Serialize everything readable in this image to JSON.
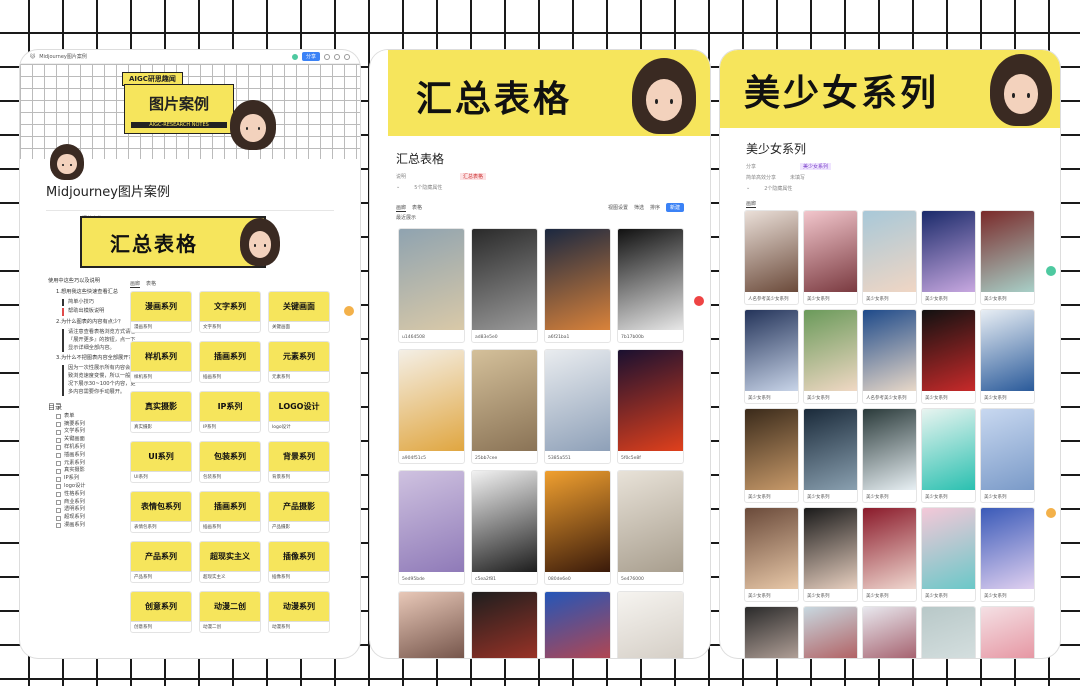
{
  "panel1": {
    "tab_title": "Midjourney图片案例",
    "share": "分享",
    "cover_badge": "AIGC研思趣闻",
    "cover_title": "图片案例",
    "cover_sub": "AIGC-RESEARCH NOTES",
    "doc_title": "Midjourney图片案例",
    "section_tag": "汇总表格",
    "banner_text": "汇总表格",
    "toc": {
      "head": "使用中这些巧以及说明",
      "q1": "1.想用我这些快速查看汇总",
      "q1a": "简单小技巧",
      "q1b": "帮助出模板说明",
      "q2": "2.为什么图表的内容有点少？",
      "q2a": "请注意查看表格浏览方式请看『展开更多』的按钮，点一下显示详细全部内容。",
      "q3": "3.为什么不把图表内容全部展开？",
      "q3a": "因为一次性展示所有内容会导致浏览速度变慢，所以一般情况下展示30~100个内容，更多内容需要你手动展开。",
      "dir_title": "目录",
      "dir_tab": "表单",
      "dir_items": [
        "摘要系列",
        "文学系列",
        "关键画面",
        "样机系列",
        "插画系列",
        "元素系列",
        "真实摄影",
        "IP系列",
        "logo设计",
        "性格系列",
        "商业系列",
        "透明系列",
        "超现系列",
        "漫画系列"
      ]
    },
    "gallery_tabs": [
      "画廊",
      "表格"
    ],
    "cards": [
      {
        "thumb": "漫画系列",
        "cap": "漫画系列"
      },
      {
        "thumb": "文字系列",
        "cap": "文字系列"
      },
      {
        "thumb": "关键画面",
        "cap": "关键画面"
      },
      {
        "thumb": "样机系列",
        "cap": "样机系列"
      },
      {
        "thumb": "插画系列",
        "cap": "插画系列"
      },
      {
        "thumb": "元素系列",
        "cap": "元素系列"
      },
      {
        "thumb": "真实摄影",
        "cap": "真实摄影"
      },
      {
        "thumb": "IP系列",
        "cap": "IP系列"
      },
      {
        "thumb": "LOGO设计",
        "cap": "logo设计"
      },
      {
        "thumb": "UI系列",
        "cap": "UI系列"
      },
      {
        "thumb": "包装系列",
        "cap": "包装系列"
      },
      {
        "thumb": "背景系列",
        "cap": "背景系列"
      },
      {
        "thumb": "表情包系列",
        "cap": "表情包系列"
      },
      {
        "thumb": "插画系列",
        "cap": "插画系列"
      },
      {
        "thumb": "产品摄影",
        "cap": "产品摄影"
      },
      {
        "thumb": "产品系列",
        "cap": "产品系列"
      },
      {
        "thumb": "超现实主义",
        "cap": "超现实主义"
      },
      {
        "thumb": "插像系列",
        "cap": "插像系列"
      },
      {
        "thumb": "创意系列",
        "cap": "创意系列"
      },
      {
        "thumb": "动漫二创",
        "cap": "动漫二创"
      },
      {
        "thumb": "动漫系列",
        "cap": "动漫系列"
      }
    ]
  },
  "panel2": {
    "header": "汇总表格",
    "title": "汇总表格",
    "meta_owner": "说明",
    "meta_tag": "汇总表格",
    "meta_more": "5个隐藏属性",
    "tabs": [
      "画廊",
      "表格"
    ],
    "view_name": "最近展示",
    "toolbar": [
      "视图设置",
      "筛选",
      "排序"
    ],
    "new_btn": "新建",
    "photos": [
      {
        "cap": "u1464508",
        "c1": "#8fa3b0",
        "c2": "#d9c9a8"
      },
      {
        "cap": "ad83e5e0",
        "c1": "#2a2a2a",
        "c2": "#9a9a9a"
      },
      {
        "cap": "a6f21ba1",
        "c1": "#1b2840",
        "c2": "#d9823a"
      },
      {
        "cap": "7b17b00b",
        "c1": "#111111",
        "c2": "#e8e8e8"
      },
      {
        "cap": "a904f51c5",
        "c1": "#f4efe6",
        "c2": "#e0a640"
      },
      {
        "cap": "25bb7cee",
        "c1": "#d4c09a",
        "c2": "#8a7356"
      },
      {
        "cap": "5385a551",
        "c1": "#e9ecef",
        "c2": "#8ea0b8"
      },
      {
        "cap": "5f0c5e8f",
        "c1": "#1a1030",
        "c2": "#e0401c"
      },
      {
        "cap": "5ed95bde",
        "c1": "#cfc2e0",
        "c2": "#8f7ab8"
      },
      {
        "cap": "c5ea2f81",
        "c1": "#f2f2f2",
        "c2": "#1d1d1d"
      },
      {
        "cap": "080de6e0",
        "c1": "#f0a030",
        "c2": "#3a1a0a"
      },
      {
        "cap": "5e476000",
        "c1": "#e8e2d8",
        "c2": "#a89e8e"
      },
      {
        "cap": "",
        "c1": "#e8c8b8",
        "c2": "#4a2a22"
      },
      {
        "cap": "",
        "c1": "#1e1e1e",
        "c2": "#c83a2a"
      },
      {
        "cap": "",
        "c1": "#2456b8",
        "c2": "#e8402a"
      },
      {
        "cap": "",
        "c1": "#f6f4f0",
        "c2": "#c8c0b6"
      }
    ]
  },
  "panel3": {
    "header": "美少女系列",
    "title": "美少女系列",
    "meta_owner": "分享",
    "meta_tag": "美少女系列",
    "meta_row2a": "简单高效分享",
    "meta_row2b": "未填写",
    "meta_more": "2个隐藏属性",
    "tab": "画廊",
    "photos": [
      {
        "cap": "人名参考美少女系列",
        "c1": "#eadfd8",
        "c2": "#6b4a3a"
      },
      {
        "cap": "美少女系列",
        "c1": "#f2c6cc",
        "c2": "#7a3a40"
      },
      {
        "cap": "美少女系列",
        "c1": "#a8c8d8",
        "c2": "#f0d6c4"
      },
      {
        "cap": "美少女系列",
        "c1": "#1a2a6a",
        "c2": "#c8a8e0"
      },
      {
        "cap": "美少女系列",
        "c1": "#7a2a2a",
        "c2": "#a8d0c8"
      },
      {
        "cap": "美少女系列",
        "c1": "#24345a",
        "c2": "#c8d4e8"
      },
      {
        "cap": "美少女系列",
        "c1": "#6a9a5a",
        "c2": "#f0d8c4"
      },
      {
        "cap": "人名参考美少女系列",
        "c1": "#1e4a8a",
        "c2": "#e8d8c8"
      },
      {
        "cap": "美少女系列",
        "c1": "#111111",
        "c2": "#c82a2a"
      },
      {
        "cap": "美少女系列",
        "c1": "#e8eef4",
        "c2": "#2a5a9a"
      },
      {
        "cap": "美少女系列",
        "c1": "#3a2a1a",
        "c2": "#c89a6a"
      },
      {
        "cap": "美少女系列",
        "c1": "#1a2a3a",
        "c2": "#8aa0b0"
      },
      {
        "cap": "美少女系列",
        "c1": "#2a3a3a",
        "c2": "#e8f0f4"
      },
      {
        "cap": "美少女系列",
        "c1": "#e8f4f0",
        "c2": "#2ac0b0"
      },
      {
        "cap": "美少女系列",
        "c1": "#c8d8f0",
        "c2": "#7a9ac8"
      },
      {
        "cap": "美少女系列",
        "c1": "#6a4a3a",
        "c2": "#e8c8a8"
      },
      {
        "cap": "美少女系列",
        "c1": "#1a1a1a",
        "c2": "#e8d0c0"
      },
      {
        "cap": "美少女系列",
        "c1": "#8a1a2a",
        "c2": "#f0d8d0"
      },
      {
        "cap": "美少女系列",
        "c1": "#f4c8d8",
        "c2": "#6ac8c8"
      },
      {
        "cap": "美少女系列",
        "c1": "#3a5ab8",
        "c2": "#e0d0f0"
      },
      {
        "cap": "",
        "c1": "#2a2a2a",
        "c2": "#e8d0c4"
      },
      {
        "cap": "",
        "c1": "#c8d8e0",
        "c2": "#a83030"
      },
      {
        "cap": "",
        "c1": "#e8e8ee",
        "c2": "#8a2a3a"
      },
      {
        "cap": "",
        "c1": "#b8c8c8",
        "c2": "#e0e8e8"
      },
      {
        "cap": "",
        "c1": "#f4e0e4",
        "c2": "#e07888"
      }
    ]
  },
  "colors": {
    "accent_yellow": "#f6e55c",
    "brand_blue": "#3b82f6",
    "grid_line": "#1a1a1a"
  }
}
